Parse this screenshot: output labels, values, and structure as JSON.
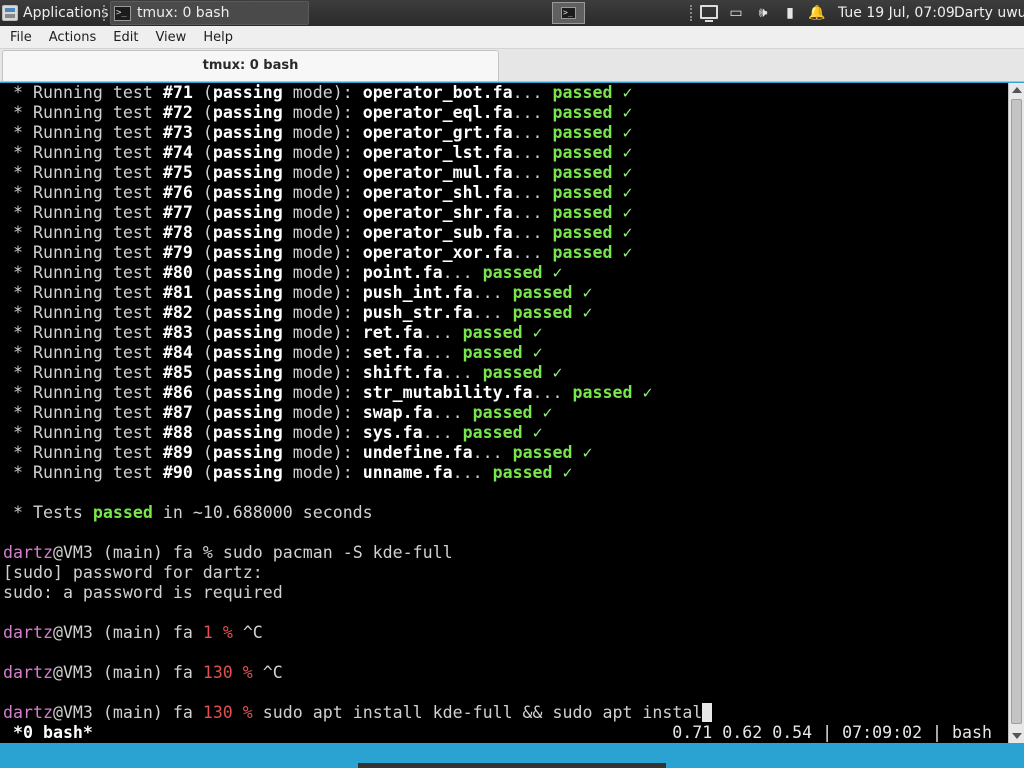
{
  "panel": {
    "applications_label": "Applications",
    "task_label": "tmux: 0 bash",
    "tray_icons": [
      "monitor-icon",
      "battery-tray-icon",
      "volume-icon",
      "power-icon",
      "bell-icon"
    ],
    "clock": "Tue 19 Jul, 07:09",
    "user": "Darty uwu"
  },
  "menu": [
    "File",
    "Actions",
    "Edit",
    "View",
    "Help"
  ],
  "tab": {
    "title": "tmux: 0 bash"
  },
  "terminal": {
    "tests": [
      {
        "num": "#71",
        "file": "operator_bot.fa"
      },
      {
        "num": "#72",
        "file": "operator_eql.fa"
      },
      {
        "num": "#73",
        "file": "operator_grt.fa"
      },
      {
        "num": "#74",
        "file": "operator_lst.fa"
      },
      {
        "num": "#75",
        "file": "operator_mul.fa"
      },
      {
        "num": "#76",
        "file": "operator_shl.fa"
      },
      {
        "num": "#77",
        "file": "operator_shr.fa"
      },
      {
        "num": "#78",
        "file": "operator_sub.fa"
      },
      {
        "num": "#79",
        "file": "operator_xor.fa"
      },
      {
        "num": "#80",
        "file": "point.fa"
      },
      {
        "num": "#81",
        "file": "push_int.fa"
      },
      {
        "num": "#82",
        "file": "push_str.fa"
      },
      {
        "num": "#83",
        "file": "ret.fa"
      },
      {
        "num": "#84",
        "file": "set.fa"
      },
      {
        "num": "#85",
        "file": "shift.fa"
      },
      {
        "num": "#86",
        "file": "str_mutability.fa"
      },
      {
        "num": "#87",
        "file": "swap.fa"
      },
      {
        "num": "#88",
        "file": "sys.fa"
      },
      {
        "num": "#89",
        "file": "undefine.fa"
      },
      {
        "num": "#90",
        "file": "unname.fa"
      }
    ],
    "test_prefix": " * Running test ",
    "mode_open": " (",
    "mode_word": "passing",
    "mode_rest": " mode): ",
    "ellipsis": "... ",
    "passed": "passed",
    "check": " ✓",
    "summary": {
      "prefix": " * Tests ",
      "passed": "passed",
      "rest": " in ~10.688000 seconds"
    },
    "user": "dartz",
    "host": "@VM3 (main) fa",
    "history": [
      {
        "type": "prompt",
        "code": "",
        "cmd": "sudo pacman -S kde-full"
      },
      {
        "type": "out",
        "text": "[sudo] password for dartz:"
      },
      {
        "type": "out",
        "text": "sudo: a password is required"
      },
      {
        "type": "blank"
      },
      {
        "type": "prompt",
        "code": "1",
        "cmd": "^C"
      },
      {
        "type": "blank"
      },
      {
        "type": "prompt",
        "code": "130",
        "cmd": "^C"
      },
      {
        "type": "blank"
      },
      {
        "type": "prompt",
        "code": "130",
        "cmd": "sudo apt install kde-full && sudo apt instal",
        "cursor": true
      }
    ],
    "status_left": " *0 bash*",
    "status_right": "0.71 0.62 0.54 | 07:09:02 | bash"
  }
}
